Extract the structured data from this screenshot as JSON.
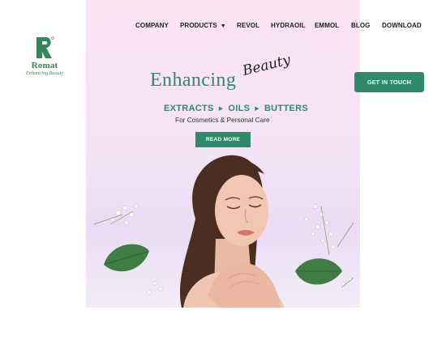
{
  "brand": {
    "name": "Romat",
    "tagline": "Enhancing Beauty",
    "logo_icon": "r-monogram-icon",
    "accent_color": "#2e8b69"
  },
  "nav": {
    "items": [
      {
        "label": "COMPANY"
      },
      {
        "label": "PRODUCTS",
        "has_dropdown": true
      },
      {
        "label": "REVOL"
      },
      {
        "label": "HYDRAOIL"
      },
      {
        "label": "EMMOL"
      },
      {
        "label": "BLOG"
      },
      {
        "label": "DOWNLOAD"
      }
    ],
    "dropdown_icon": "caret-down-icon"
  },
  "cta": {
    "label": "GET IN TOUCH"
  },
  "hero": {
    "headline": "Enhancing",
    "script_word": "Beauty",
    "categories": [
      "EXTRACTS",
      "OILS",
      "BUTTERS"
    ],
    "separator_icon": "triangle-right-icon",
    "subtitle": "For Cosmetics & Personal Care",
    "button_label": "READ MORE",
    "background_top": "#fbe4f2",
    "background_bottom": "#eadcf4"
  }
}
